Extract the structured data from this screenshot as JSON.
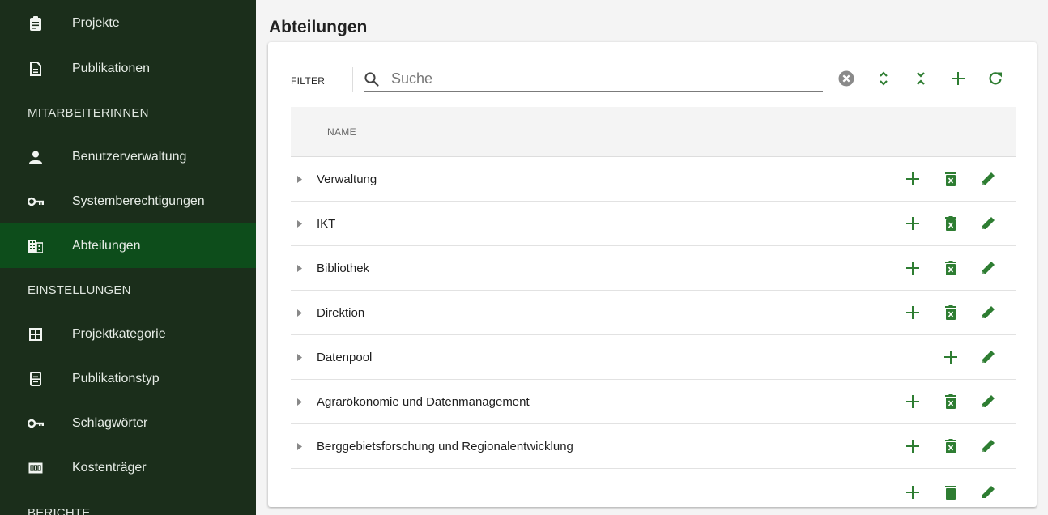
{
  "sidebar": {
    "items": [
      {
        "label": "Projekte",
        "icon": "clipboard-icon"
      },
      {
        "label": "Publikationen",
        "icon": "document-icon"
      }
    ],
    "section_mitarbeiter": "MITARBEITERINNEN",
    "items_mitarbeiter": [
      {
        "label": "Benutzerverwaltung",
        "icon": "person-icon"
      },
      {
        "label": "Systemberechtigungen",
        "icon": "key-icon"
      },
      {
        "label": "Abteilungen",
        "icon": "building-icon",
        "active": true
      }
    ],
    "section_einstellungen": "EINSTELLUNGEN",
    "items_einstellungen": [
      {
        "label": "Projektkategorie",
        "icon": "grid-icon"
      },
      {
        "label": "Publikationstyp",
        "icon": "form-icon"
      },
      {
        "label": "Schlagwörter",
        "icon": "key-icon"
      },
      {
        "label": "Kostenträger",
        "icon": "counter-icon"
      }
    ],
    "section_berichte": "BERICHTE"
  },
  "page": {
    "title": "Abteilungen"
  },
  "toolbar": {
    "filter_label": "FILTER",
    "search_placeholder": "Suche",
    "search_value": ""
  },
  "table": {
    "column_name": "NAME",
    "rows": [
      {
        "name": "Verwaltung",
        "can_delete": true
      },
      {
        "name": "IKT",
        "can_delete": true
      },
      {
        "name": "Bibliothek",
        "can_delete": true
      },
      {
        "name": "Direktion",
        "can_delete": true
      },
      {
        "name": "Datenpool",
        "can_delete": false
      },
      {
        "name": "Agrarökonomie und Datenmanagement",
        "can_delete": true
      },
      {
        "name": "Berggebietsforschung und Regionalentwicklung",
        "can_delete": true
      }
    ]
  },
  "colors": {
    "sidebar_bg": "#1b2e1b",
    "sidebar_active": "#0d4d1b",
    "accent_green": "#2e7d32",
    "clear_icon": "#8a8a8a"
  }
}
